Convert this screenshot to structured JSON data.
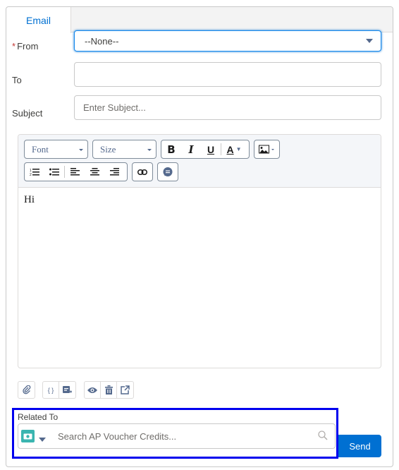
{
  "tabs": [
    {
      "label": "Email",
      "active": true
    }
  ],
  "form": {
    "from": {
      "label": "From",
      "required_marker": "*",
      "value": "--None--"
    },
    "to": {
      "label": "To",
      "value": ""
    },
    "subject": {
      "label": "Subject",
      "value": "",
      "placeholder": "Enter Subject..."
    }
  },
  "editor": {
    "font_label": "Font",
    "size_label": "Size",
    "toolbar_icons": [
      "bold-icon",
      "italic-icon",
      "underline-icon",
      "font-color-icon",
      "image-icon",
      "numbered-list-icon",
      "bulleted-list-icon",
      "align-left-icon",
      "align-center-icon",
      "align-right-icon",
      "link-icon",
      "comment-icon"
    ],
    "body": "Hi"
  },
  "bottom_actions": [
    "attach-icon",
    "merge-field-icon",
    "insert-template-icon",
    "preview-icon",
    "delete-icon",
    "popout-icon"
  ],
  "related_to": {
    "label": "Related To",
    "placeholder": "Search AP Voucher Credits...",
    "value": ""
  },
  "send_label": "Send",
  "colors": {
    "accent": "#0070d2",
    "object_icon": "#3ab5b0",
    "highlight": "#0000ee",
    "required": "#c23934"
  }
}
